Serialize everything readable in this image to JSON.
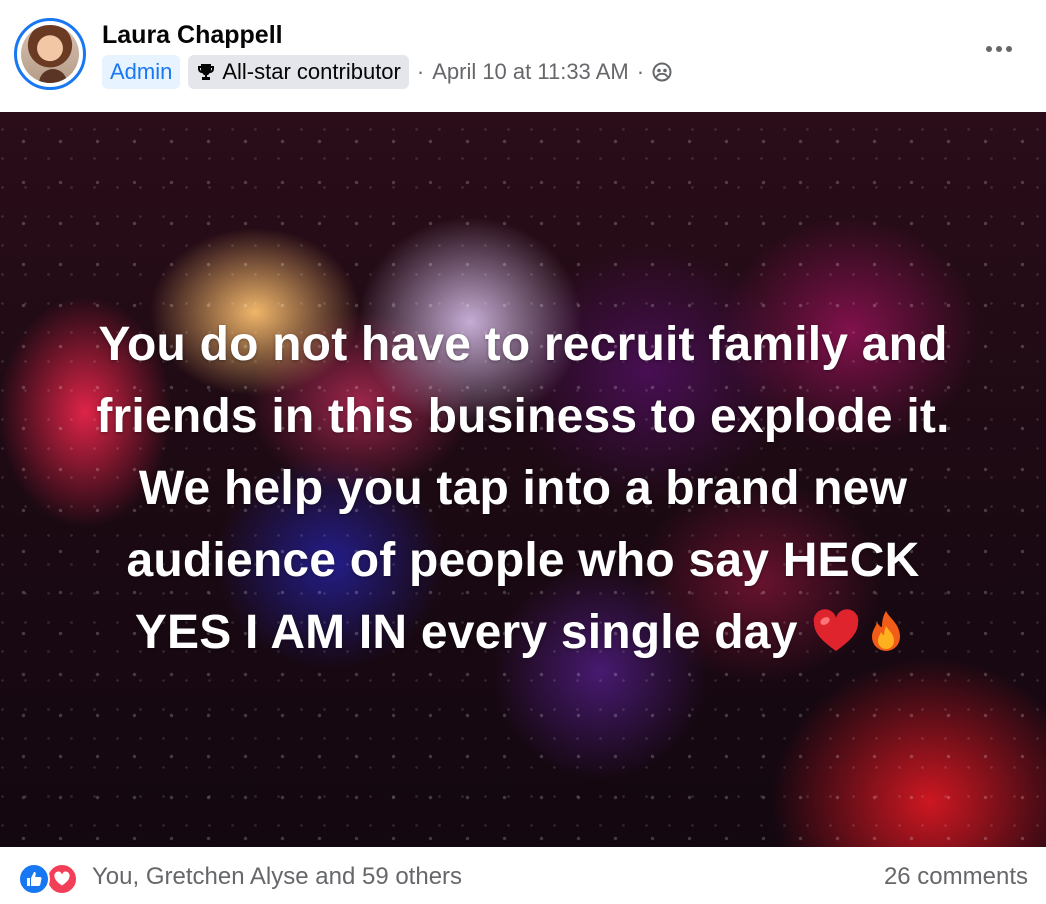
{
  "post": {
    "author": {
      "name": "Laura Chappell",
      "avatar_icon": "profile-photo"
    },
    "badges": {
      "admin": "Admin",
      "contributor_icon": "trophy-icon",
      "contributor": "All-star contributor"
    },
    "separator": "·",
    "timestamp": "April 10 at 11:33 AM",
    "audience_icon": "group-audience-icon",
    "more_icon": "more-options-icon",
    "text_lines": [
      "You do not have to recruit family and",
      "friends in this business to explode it.",
      "We help you tap into a brand new",
      "audience of people who say HECK",
      "YES I AM IN every single day"
    ],
    "emojis": [
      "red-heart",
      "fire"
    ]
  },
  "footer": {
    "reactions": [
      "like",
      "love"
    ],
    "reactors_text": "You, Gretchen Alyse and 59 others",
    "comments_text": "26 comments"
  },
  "colors": {
    "accent": "#1877f2",
    "secondary_text": "#65676b",
    "love": "#f33e58"
  }
}
